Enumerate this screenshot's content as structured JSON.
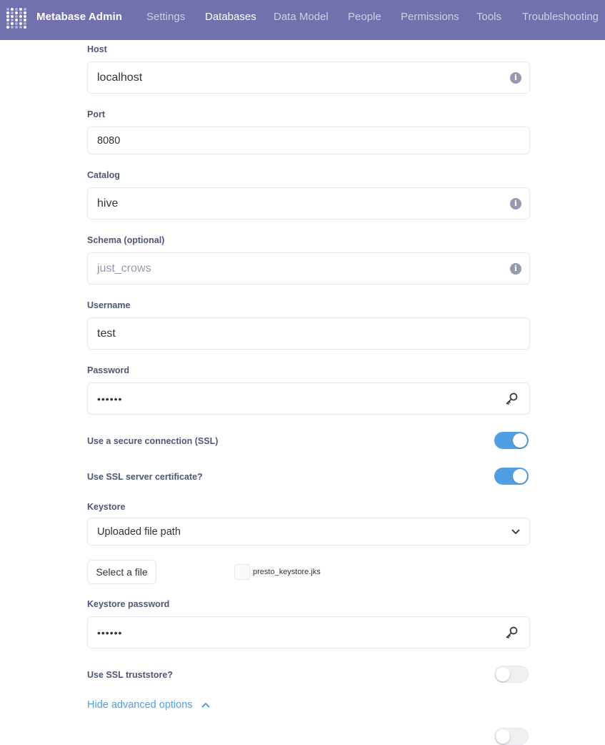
{
  "header": {
    "brand": "Metabase Admin",
    "nav": [
      {
        "label": "Settings",
        "active": false
      },
      {
        "label": "Databases",
        "active": true
      },
      {
        "label": "Data Model",
        "active": false
      },
      {
        "label": "People",
        "active": false
      },
      {
        "label": "Permissions",
        "active": false
      },
      {
        "label": "Tools",
        "active": false
      },
      {
        "label": "Troubleshooting",
        "active": false
      }
    ]
  },
  "form": {
    "host": {
      "label": "Host",
      "value": "localhost"
    },
    "port": {
      "label": "Port",
      "value": "8080"
    },
    "catalog": {
      "label": "Catalog",
      "value": "hive"
    },
    "schema": {
      "label": "Schema (optional)",
      "placeholder": "just_crows"
    },
    "username": {
      "label": "Username",
      "value": "test"
    },
    "password": {
      "label": "Password",
      "value": "••••••"
    },
    "ssl": {
      "label": "Use a secure connection (SSL)",
      "on": true
    },
    "ssl_cert": {
      "label": "Use SSL server certificate?",
      "on": true
    },
    "keystore": {
      "label": "Keystore",
      "value": "Uploaded file path"
    },
    "file_button": "Select a file",
    "file_name": "presto_keystore.jks",
    "keystore_password": {
      "label": "Keystore password",
      "value": "••••••"
    },
    "truststore": {
      "label": "Use SSL truststore?",
      "on": false
    },
    "advanced_link": "Hide advanced options"
  },
  "colors": {
    "header_bg": "#7172ad",
    "accent": "#509ee3",
    "text": "#4c5773",
    "border": "#e6e8ec"
  }
}
